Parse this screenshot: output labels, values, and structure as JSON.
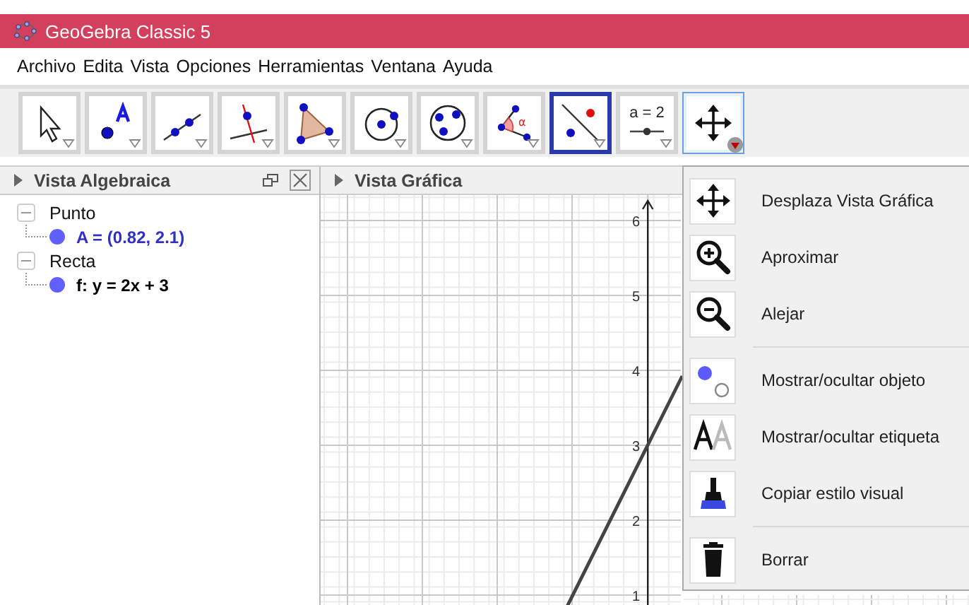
{
  "window": {
    "title": "GeoGebra Classic 5"
  },
  "menu_bar": [
    "Archivo",
    "Edita",
    "Vista",
    "Opciones",
    "Herramientas",
    "Ventana",
    "Ayuda"
  ],
  "toolbar": [
    {
      "kind": "move",
      "selected": false,
      "open": false
    },
    {
      "kind": "point",
      "selected": false,
      "open": false
    },
    {
      "kind": "line",
      "selected": false,
      "open": false
    },
    {
      "kind": "perpendicular",
      "selected": false,
      "open": false
    },
    {
      "kind": "polygon",
      "selected": false,
      "open": false
    },
    {
      "kind": "circle",
      "selected": false,
      "open": false
    },
    {
      "kind": "conic",
      "selected": false,
      "open": false
    },
    {
      "kind": "angle",
      "label": "α",
      "selected": false,
      "open": false
    },
    {
      "kind": "reflect",
      "selected": true,
      "open": false
    },
    {
      "kind": "slider",
      "label": "a = 2",
      "selected": false,
      "open": false
    },
    {
      "kind": "pan",
      "selected": false,
      "open": true
    }
  ],
  "algebra_view": {
    "title": "Vista Algebraica",
    "groups": [
      {
        "label": "Punto",
        "expanded": true,
        "children": [
          {
            "label": "A = (0.82, 2.1)",
            "color": "#6060ff",
            "highlighted": true
          }
        ]
      },
      {
        "label": "Recta",
        "expanded": true,
        "children": [
          {
            "label": "f: y = 2x + 3",
            "color": "#6060ff",
            "highlighted": false
          }
        ]
      }
    ]
  },
  "graphics_view": {
    "title": "Vista Gráfica",
    "y_axis_labels": [
      "6",
      "5",
      "4",
      "3",
      "2",
      "1"
    ]
  },
  "tool_menu": [
    {
      "kind": "pan",
      "label": "Desplaza Vista Gráfica",
      "separator_before": false
    },
    {
      "kind": "zoom-in",
      "label": "Aproximar",
      "separator_before": false
    },
    {
      "kind": "zoom-out",
      "label": "Alejar",
      "separator_before": false
    },
    {
      "kind": "show-object",
      "label": "Mostrar/ocultar objeto",
      "separator_before": true
    },
    {
      "kind": "show-label",
      "label": "Mostrar/ocultar etiqueta",
      "separator_before": false
    },
    {
      "kind": "copy-style",
      "label": "Copiar estilo visual",
      "separator_before": false
    },
    {
      "kind": "delete",
      "label": "Borrar",
      "separator_before": true
    }
  ]
}
